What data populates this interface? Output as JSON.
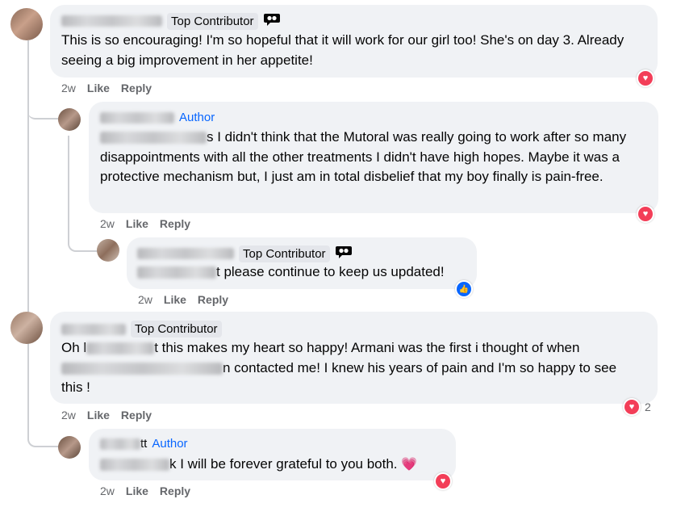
{
  "comments": [
    {
      "badge": "Top Contributor",
      "text": "This is so encouraging! I'm so hopeful that it will work for our girl too! She's on day 3. Already seeing a big improvement in her appetite!",
      "time": "2w",
      "like": "Like",
      "reply": "Reply",
      "reaction": "heart-love"
    },
    {
      "badge": "Author",
      "text_visible": "s I didn't think that the Mutoral was really going to work after so many disappointments with all the other treatments I didn't have high hopes. Maybe it was a protective mechanism but, I just am in total disbelief that my boy finally is pain-free.",
      "time": "2w",
      "like": "Like",
      "reply": "Reply",
      "reaction": "heart-love"
    },
    {
      "badge": "Top Contributor",
      "text_visible": "t please continue to keep us updated!",
      "time": "2w",
      "like": "Like",
      "reply": "Reply",
      "reaction": "thumbs-up"
    },
    {
      "badge": "Top Contributor",
      "text_start": "Oh l",
      "text_line1_end": "t this makes my heart so happy! Armani was the first i thought of when",
      "text_line2_end": "n contacted me! I knew his years of pain and I'm so happy to see",
      "text_line3": "this !",
      "time": "2w",
      "like": "Like",
      "reply": "Reply",
      "reaction": "heart-love",
      "reaction_count": "2"
    },
    {
      "name_partial": "tt",
      "badge": "Author",
      "text_visible": "k I will be forever grateful to you both.",
      "time": "2w",
      "like": "Like",
      "reply": "Reply",
      "reaction": "heart-love"
    }
  ],
  "colors": {
    "link_blue": "#0866ff",
    "bubble": "#f0f2f5",
    "meta": "#65676b",
    "love": "#f33e58",
    "like": "#0866ff"
  }
}
